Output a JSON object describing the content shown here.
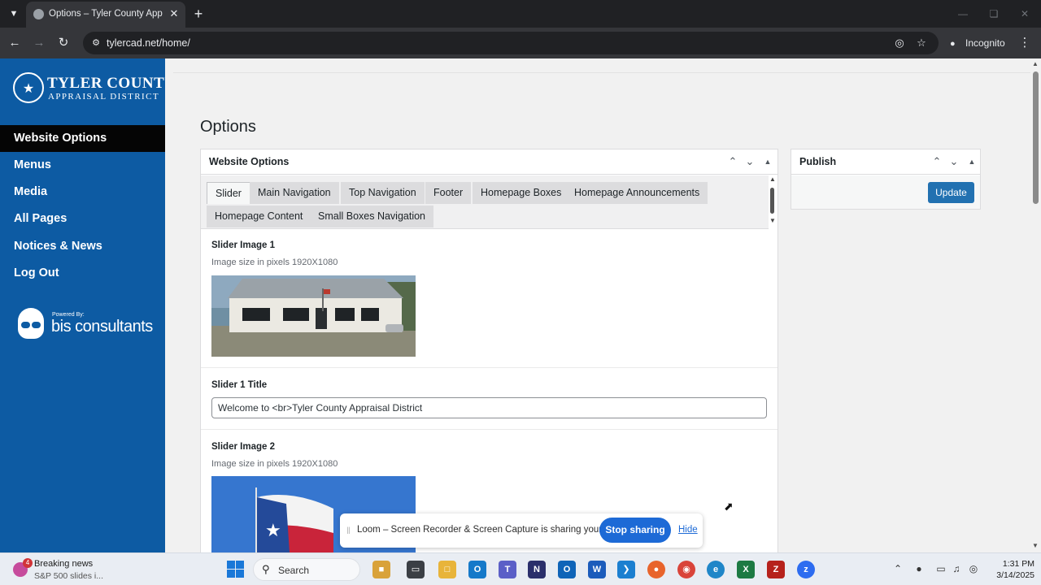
{
  "browser": {
    "tab_title": "Options – Tyler County Apprais",
    "url": "tylercad.net/home/",
    "incognito_label": "Incognito"
  },
  "sidebar": {
    "logo_line1": "TYLER COUNTY",
    "logo_line2": "APPRAISAL DISTRICT",
    "items": [
      {
        "label": "Website Options"
      },
      {
        "label": "Menus"
      },
      {
        "label": "Media"
      },
      {
        "label": "All Pages"
      },
      {
        "label": "Notices & News"
      },
      {
        "label": "Log Out"
      }
    ],
    "powered_by_label": "Powered By:",
    "powered_by_name": "bis consultants"
  },
  "main": {
    "page_title": "Options",
    "box_title": "Website Options",
    "tabs": [
      {
        "label": "Slider"
      },
      {
        "label": "Main Navigation"
      },
      {
        "label": "Top Navigation"
      },
      {
        "label": "Footer"
      },
      {
        "label": "Homepage Boxes"
      },
      {
        "label": "Homepage Announcements"
      },
      {
        "label": "Homepage Content"
      },
      {
        "label": "Small Boxes Navigation"
      }
    ],
    "slider1_image_label": "Slider Image 1",
    "slider1_image_desc": "Image size in pixels 1920X1080",
    "slider1_title_label": "Slider 1 Title",
    "slider1_title_value": "Welcome to <br>Tyler County Appraisal District",
    "slider2_image_label": "Slider Image 2",
    "slider2_image_desc": "Image size in pixels 1920X1080"
  },
  "publish": {
    "title": "Publish",
    "update_label": "Update"
  },
  "loom": {
    "message": "Loom – Screen Recorder & Screen Capture is sharing your screen.",
    "stop_label": "Stop sharing",
    "hide_label": "Hide"
  },
  "taskbar": {
    "news_badge": "4",
    "news_title": "Breaking news",
    "news_sub": "S&P 500 slides i...",
    "search_label": "Search",
    "time": "1:31 PM",
    "date": "3/14/2025"
  },
  "colors": {
    "sidebar_bg": "#0d5ba3",
    "active_menu_bg": "#050505",
    "primary_button": "#2271b1",
    "loom_blue": "#1d6ad6"
  }
}
